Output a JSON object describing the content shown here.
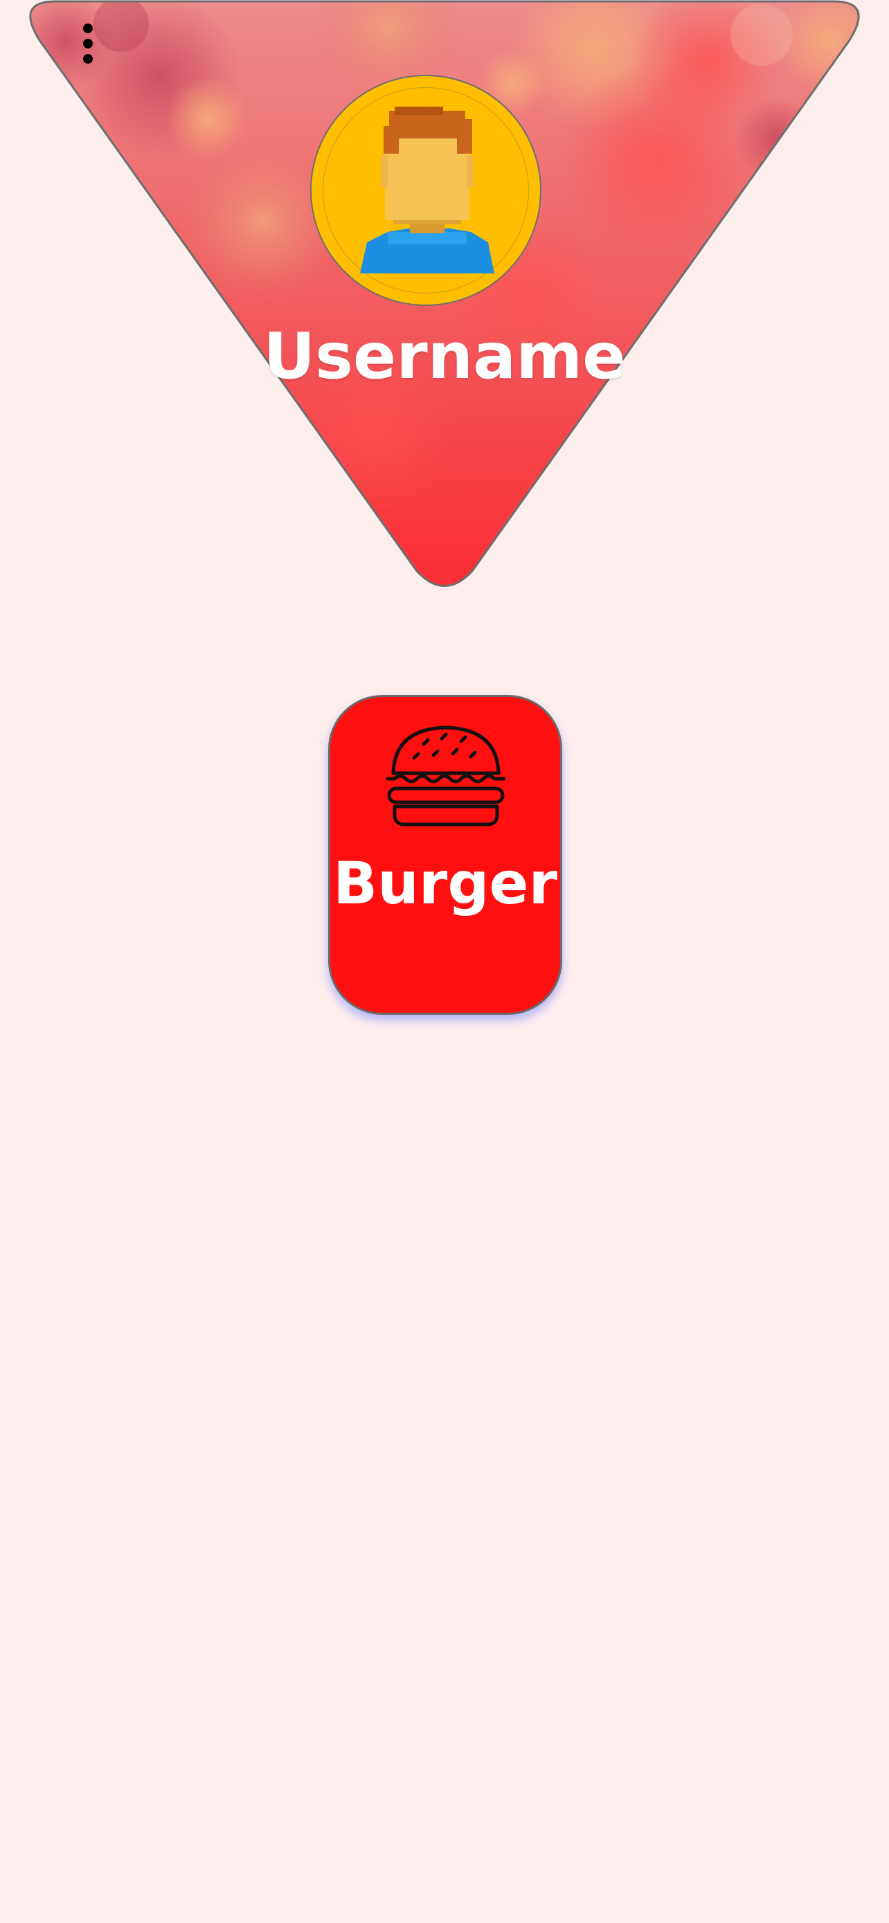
{
  "header": {
    "menu_icon": "more-vertical-icon",
    "background_image": "fruit-photo",
    "avatar_icon": "user-avatar-icon",
    "username": "Username"
  },
  "categories": [
    {
      "label": "Burger",
      "icon": "burger-icon",
      "color": "#ff0f0f"
    }
  ],
  "colors": {
    "page_background": "#fdeeee",
    "header_tint": "#f4474d",
    "avatar_background": "#ffbf00"
  }
}
